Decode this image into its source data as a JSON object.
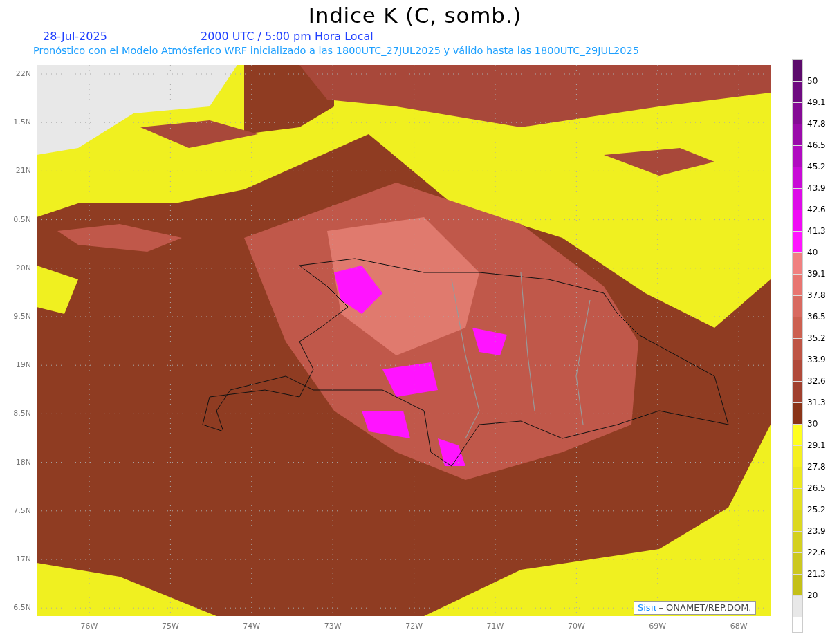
{
  "title": "Indice K (C, somb.)",
  "date": "28-Jul-2025",
  "time": "2000 UTC / 5:00 pm Hora Local",
  "subtitle": "Pronóstico con el Modelo Atmósferico WRF inicializado a las 1800UTC_27JUL2025 y válido hasta las  1800UTC_29JUL2025",
  "lat_labels": [
    "22N",
    "1.5N",
    "21N",
    "0.5N",
    "20N",
    "9.5N",
    "19N",
    "8.5N",
    "18N",
    "7.5N",
    "17N",
    "6.5N"
  ],
  "lon_labels": [
    "76W",
    "75W",
    "74W",
    "73W",
    "72W",
    "71W",
    "70W",
    "69W",
    "68W"
  ],
  "credit": {
    "logo": "Sisπ",
    "text": "– ONAMET/REP.DOM."
  },
  "colorbar": [
    {
      "color": "#5c0a6b",
      "label": "50"
    },
    {
      "color": "#6e0a80",
      "label": "49.1"
    },
    {
      "color": "#850a95",
      "label": "47.8"
    },
    {
      "color": "#9a0aaa",
      "label": "46.5"
    },
    {
      "color": "#b00ac0",
      "label": "45.2"
    },
    {
      "color": "#c80ad6",
      "label": "43.9"
    },
    {
      "color": "#dd0ae8",
      "label": "42.6"
    },
    {
      "color": "#f00af5",
      "label": "41.3"
    },
    {
      "color": "#ff14ff",
      "label": "40"
    },
    {
      "color": "#f08080",
      "label": "39.1"
    },
    {
      "color": "#e87570",
      "label": "37.8"
    },
    {
      "color": "#d86a60",
      "label": "36.5"
    },
    {
      "color": "#cc6050",
      "label": "35.2"
    },
    {
      "color": "#be5545",
      "label": "33.9"
    },
    {
      "color": "#b04a3a",
      "label": "32.6"
    },
    {
      "color": "#a0402e",
      "label": "31.3"
    },
    {
      "color": "#8a3418",
      "label": "30"
    },
    {
      "color": "#ffff20",
      "label": "29.1"
    },
    {
      "color": "#f5f020",
      "label": "27.8"
    },
    {
      "color": "#ece820",
      "label": "26.5"
    },
    {
      "color": "#e4e020",
      "label": "25.2"
    },
    {
      "color": "#dcd820",
      "label": "23.9"
    },
    {
      "color": "#d4d020",
      "label": "22.6"
    },
    {
      "color": "#ccc820",
      "label": "21.3"
    },
    {
      "color": "#c4c018",
      "label": "20"
    },
    {
      "color": "#e8e8e8"
    }
  ]
}
